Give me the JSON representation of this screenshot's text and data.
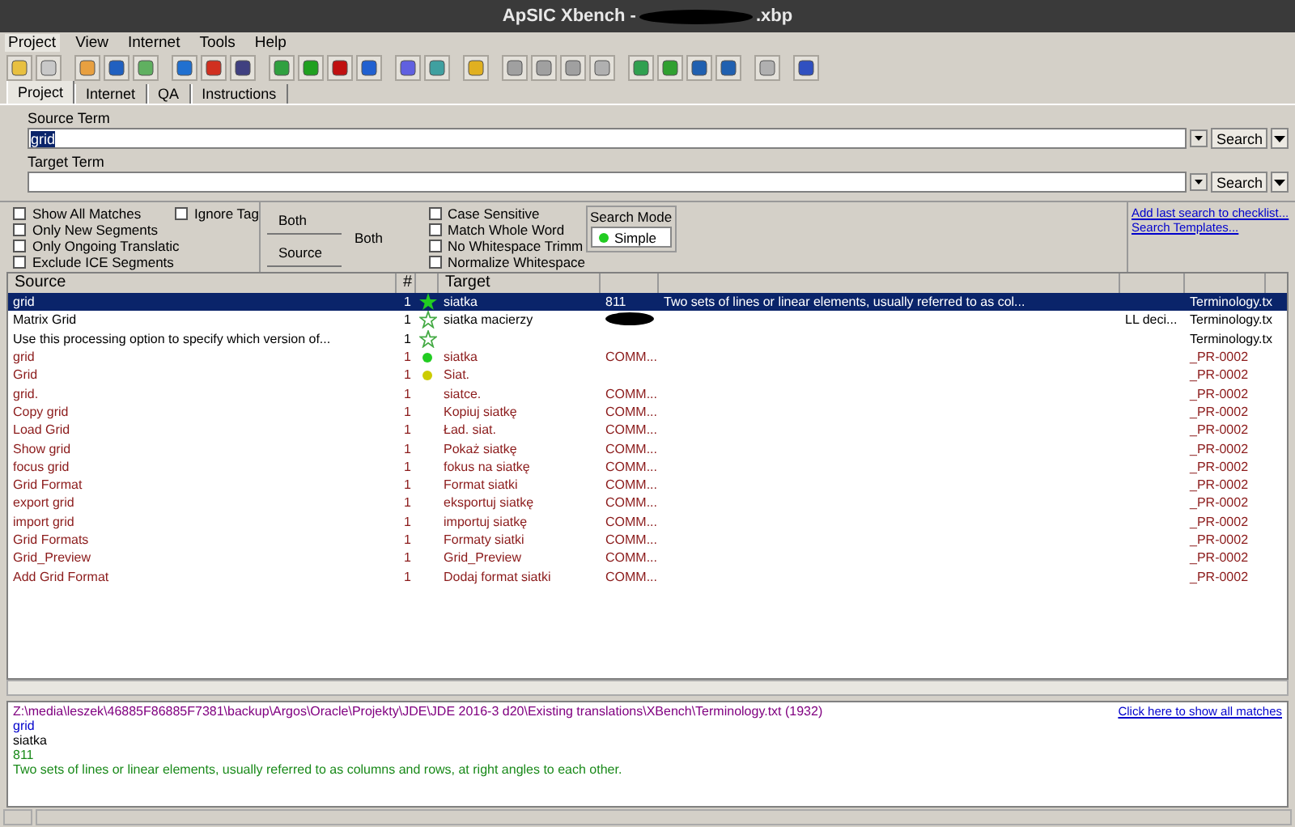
{
  "window": {
    "title_start": "ApSIC Xbench -",
    "title_end": ".xbp"
  },
  "menu": [
    {
      "label": "Project",
      "selected": true
    },
    {
      "label": "View",
      "selected": false
    },
    {
      "label": "Internet",
      "selected": false
    },
    {
      "label": "Tools",
      "selected": false
    },
    {
      "label": "Help",
      "selected": false
    }
  ],
  "tabs": [
    {
      "label": "Project",
      "selected": true
    },
    {
      "label": "Internet",
      "selected": false
    },
    {
      "label": "QA",
      "selected": false
    },
    {
      "label": "Instructions",
      "selected": false
    }
  ],
  "source_term": {
    "label": "Source Term",
    "value": "grid",
    "button": "Search"
  },
  "target_term": {
    "label": "Target Term",
    "button": "Search"
  },
  "options_left": [
    {
      "label": "Show All Matches",
      "checked": false
    },
    {
      "label": "Only New Segments",
      "checked": false
    },
    {
      "label": "Only Ongoing Translatic",
      "checked": false
    },
    {
      "label": "Exclude ICE Segments",
      "checked": false
    }
  ],
  "ignore_tags": {
    "label": "Ignore Tag",
    "checked": false
  },
  "scope_buttons": [
    {
      "label": "Both",
      "selected": false
    },
    {
      "label": "Source",
      "selected": false
    }
  ],
  "scope_value": "Both",
  "options_right": [
    {
      "label": "Case Sensitive",
      "checked": false
    },
    {
      "label": "Match Whole Word",
      "checked": false
    },
    {
      "label": "No Whitespace Trimm",
      "checked": false
    },
    {
      "label": "Normalize Whitespace",
      "checked": false
    }
  ],
  "search_mode": {
    "label": "Search Mode",
    "value": "Simple"
  },
  "links": [
    "Add last search to checklist...",
    "Search Templates..."
  ],
  "table": {
    "columns": [
      "Source",
      "#",
      "",
      "Target"
    ],
    "rows": [
      {
        "source": "grid",
        "count": "1",
        "kind": "star",
        "target": "siatka",
        "column_5": "811",
        "column_6": "Two sets of lines or linear elements, usually referred to as col...",
        "file": "Terminology.tx",
        "memory": false,
        "selected": true,
        "redacted": false
      },
      {
        "source": "Matrix Grid",
        "count": "1",
        "kind": "star_outline",
        "target": "siatka macierzy",
        "column_7": "LL deci...",
        "file": "Terminology.tx",
        "memory": false,
        "selected": false,
        "redacted": true
      },
      {
        "source": "Use this processing option to specify which version of...",
        "count": "1",
        "kind": "star_outline",
        "file": "Terminology.tx",
        "memory": false,
        "selected": false,
        "redacted": false
      },
      {
        "source": "grid",
        "count": "1",
        "kind": "dot",
        "color": "#22cc22",
        "target": "siatka",
        "column_5": "COMM...",
        "file": "_PR-0002",
        "memory": true,
        "selected": false,
        "redacted": false
      },
      {
        "source": "Grid",
        "count": "1",
        "kind": "dot",
        "color": "#cccc00",
        "target": "Siat.",
        "file": "_PR-0002",
        "memory": true,
        "selected": false,
        "redacted": false
      },
      {
        "source": "grid.",
        "count": "1",
        "kind": "plain",
        "target": "siatce.",
        "column_5": "COMM...",
        "file": "_PR-0002",
        "memory": true,
        "selected": false,
        "redacted": false
      },
      {
        "source": "Copy grid",
        "count": "1",
        "kind": "plain",
        "target": "Kopiuj siatkę",
        "column_5": "COMM...",
        "file": "_PR-0002",
        "memory": true,
        "selected": false,
        "redacted": false
      },
      {
        "source": "Load Grid",
        "count": "1",
        "kind": "plain",
        "target": "Ład. siat.",
        "column_5": "COMM...",
        "file": "_PR-0002",
        "memory": true,
        "selected": false,
        "redacted": false
      },
      {
        "source": "Show grid",
        "count": "1",
        "kind": "plain",
        "target": "Pokaż siatkę",
        "column_5": "COMM...",
        "file": "_PR-0002",
        "memory": true,
        "selected": false,
        "redacted": false
      },
      {
        "source": "focus grid",
        "count": "1",
        "kind": "plain",
        "target": "fokus na siatkę",
        "column_5": "COMM...",
        "file": "_PR-0002",
        "memory": true,
        "selected": false,
        "redacted": false
      },
      {
        "source": "Grid Format",
        "count": "1",
        "kind": "plain",
        "target": "Format siatki",
        "column_5": "COMM...",
        "file": "_PR-0002",
        "memory": true,
        "selected": false,
        "redacted": false
      },
      {
        "source": "export grid",
        "count": "1",
        "kind": "plain",
        "target": "eksportuj siatkę",
        "column_5": "COMM...",
        "file": "_PR-0002",
        "memory": true,
        "selected": false,
        "redacted": false
      },
      {
        "source": "import grid",
        "count": "1",
        "kind": "plain",
        "target": "importuj siatkę",
        "column_5": "COMM...",
        "file": "_PR-0002",
        "memory": true,
        "selected": false,
        "redacted": false
      },
      {
        "source": "Grid Formats",
        "count": "1",
        "kind": "plain",
        "target": "Formaty siatki",
        "column_5": "COMM...",
        "file": "_PR-0002",
        "memory": true,
        "selected": false,
        "redacted": false
      },
      {
        "source": "Grid_Preview",
        "count": "1",
        "kind": "plain",
        "target": "Grid_Preview",
        "column_5": "COMM...",
        "file": "_PR-0002",
        "memory": true,
        "selected": false,
        "redacted": false
      },
      {
        "source": "Add Grid Format",
        "count": "1",
        "kind": "plain",
        "target": "Dodaj format siatki",
        "column_5": "COMM...",
        "file": "_PR-0002",
        "memory": true,
        "selected": false,
        "redacted": false
      }
    ]
  },
  "detail": {
    "path": "Z:\\media\\leszek\\46885F86885F7381\\backup\\Argos\\Oracle\\Projekty\\JDE\\JDE 2016-3 d20\\Existing translations\\XBench\\Terminology.txt (1932)",
    "show_all_link": "Click here to show all matches",
    "source": "grid",
    "target": "siatka",
    "id": "811",
    "note": "Two sets of lines or linear elements, usually referred to as columns and rows, at right angles to each other."
  }
}
